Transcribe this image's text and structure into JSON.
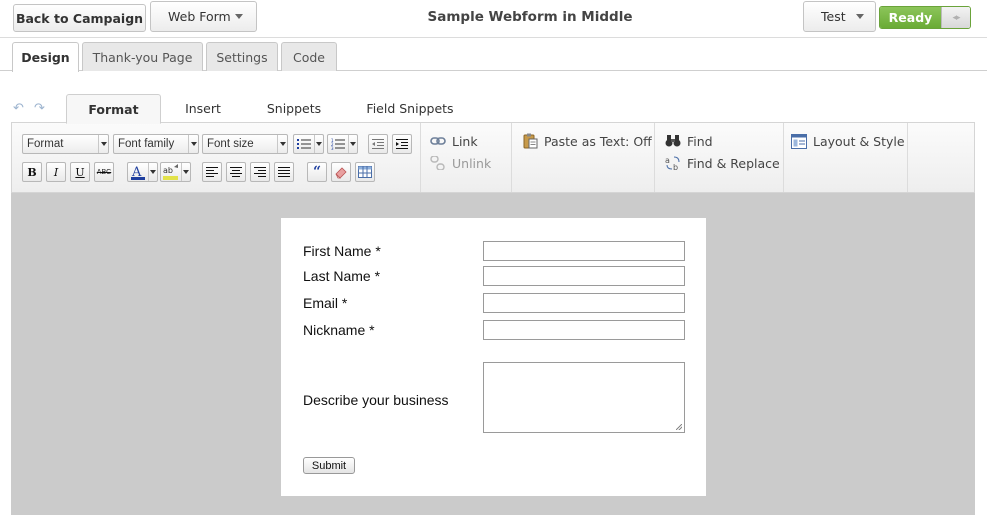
{
  "topbar": {
    "back_label": "Back to Campaign",
    "form_type": "Web Form",
    "title": "Sample Webform in Middle",
    "test_label": "Test",
    "status_label": "Ready"
  },
  "main_tabs": [
    {
      "label": "Design",
      "active": true
    },
    {
      "label": "Thank-you Page",
      "active": false
    },
    {
      "label": "Settings",
      "active": false
    },
    {
      "label": "Code",
      "active": false
    }
  ],
  "editor_tabs": [
    {
      "label": "Format",
      "active": true
    },
    {
      "label": "Insert",
      "active": false
    },
    {
      "label": "Snippets",
      "active": false
    },
    {
      "label": "Field Snippets",
      "active": false
    }
  ],
  "toolbar": {
    "format_select": "Format",
    "font_family_select": "Font family",
    "font_size_select": "Font size",
    "strike_label": "ABC",
    "link_label": "Link",
    "unlink_label": "Unlink",
    "paste_text_label": "Paste as Text: Off",
    "find_label": "Find",
    "find_replace_label": "Find & Replace",
    "layout_style_label": "Layout & Style",
    "text_color": "#1f3f9f",
    "highlight_color": "#e2e24a"
  },
  "form": {
    "fields": [
      {
        "label": "First Name *",
        "value": ""
      },
      {
        "label": "Last Name *",
        "value": ""
      },
      {
        "label": "Email *",
        "value": ""
      },
      {
        "label": "Nickname *",
        "value": ""
      }
    ],
    "textarea_label": "Describe your business",
    "textarea_value": "",
    "submit_label": "Submit"
  },
  "colors": {
    "ready_green": "#7ab648",
    "canvas_gray": "#cbcbcb"
  }
}
